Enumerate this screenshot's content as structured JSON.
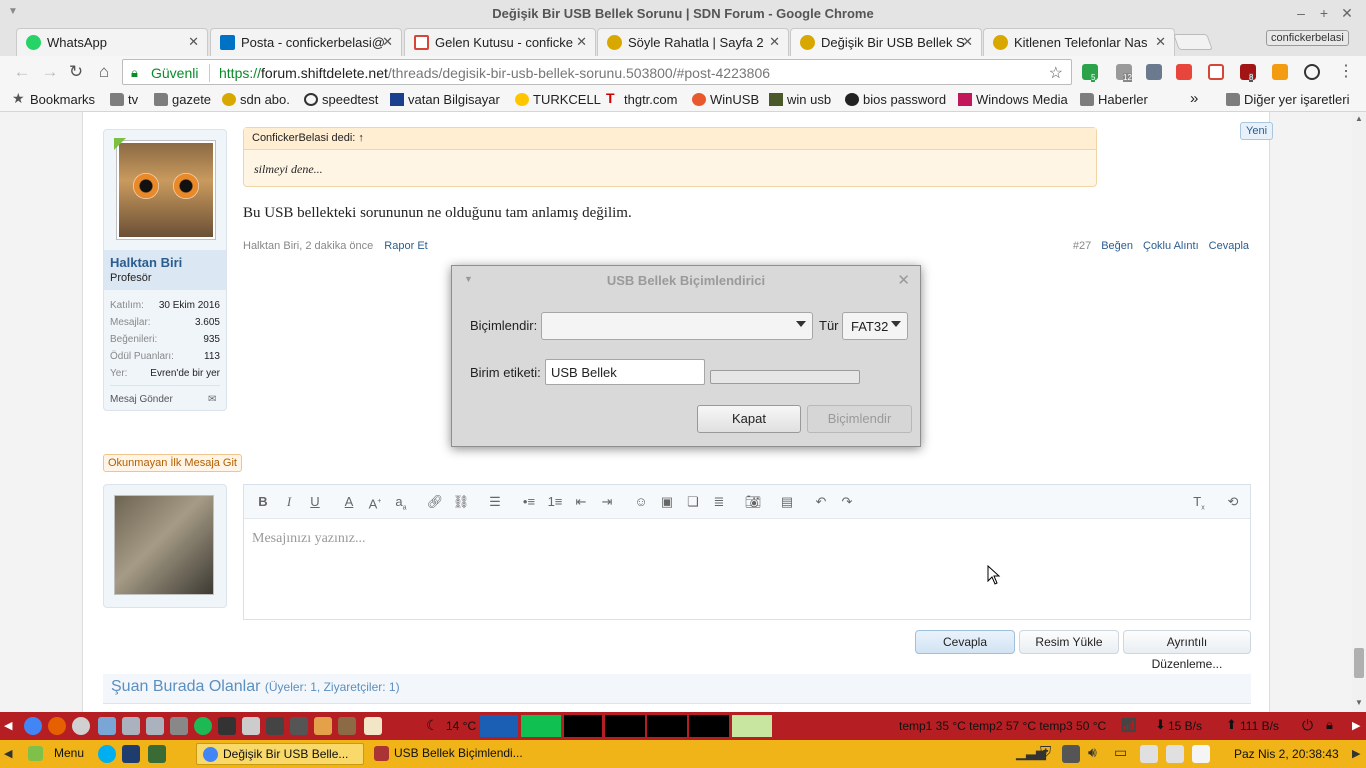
{
  "window": {
    "title": "Değişik Bir USB Bellek Sorunu | SDN Forum - Google Chrome"
  },
  "tabs": [
    {
      "label": "WhatsApp",
      "color": "#25d366"
    },
    {
      "label": "Posta - confickerbelasi@",
      "color": "#0072c6"
    },
    {
      "label": "Gelen Kutusu - conficke",
      "color": "#d44638"
    },
    {
      "label": "Söyle Rahatla | Sayfa 2",
      "color": "#d8a800"
    },
    {
      "label": "Değişik Bir USB Bellek S",
      "color": "#d8a800"
    },
    {
      "label": "Kitlenen Telefonlar Nas",
      "color": "#d8a800"
    }
  ],
  "profile_name": "confickerbelasi",
  "omnibox": {
    "secure_label": "Güvenli",
    "scheme": "https://",
    "host": "forum.shiftdelete.net",
    "path": "/threads/degisik-bir-usb-bellek-sorunu.503800/#post-4223806"
  },
  "extensions": [
    {
      "name": "extension-badge-5",
      "badge": "5"
    },
    {
      "name": "extension-badge-12",
      "badge": "12"
    },
    {
      "name": "extension-badge-8",
      "badge": "8"
    }
  ],
  "bookmarks": {
    "items": [
      "Bookmarks",
      "tv",
      "gazete",
      "sdn abo.",
      "speedtest",
      "vatan Bilgisayar",
      "TURKCELL",
      "thgtr.com",
      "WinUSB",
      "win usb",
      "bios password",
      "Windows Media",
      "Haberler"
    ],
    "overflow": "»",
    "other": "Diğer yer işaretleri"
  },
  "post": {
    "user": {
      "name": "Halktan Biri",
      "title": "Profesör",
      "stats": [
        {
          "k": "Katılım:",
          "v": "30 Ekim 2016"
        },
        {
          "k": "Mesajlar:",
          "v": "3.605"
        },
        {
          "k": "Beğenileri:",
          "v": "935"
        },
        {
          "k": "Ödül Puanları:",
          "v": "113"
        },
        {
          "k": "Yer:",
          "v": "Evren'de bir yer"
        }
      ],
      "send_message": "Mesaj Gönder"
    },
    "quote_header": "ConfickerBelasi dedi: ↑",
    "quote_body": "silmeyi dene...",
    "message": "Bu USB bellekteki sorununun ne olduğunu tam anlamış değilim.",
    "meta": "Halktan Biri, 2 dakika önce",
    "report": "Rapor Et",
    "number": "#27",
    "actions": [
      "Beğen",
      "Çoklu Alıntı",
      "Cevapla"
    ]
  },
  "new_badge": "Yeni",
  "unread_link": "Okunmayan İlk Mesaja Git",
  "editor": {
    "placeholder": "Mesajınızı yazınız..."
  },
  "form_buttons": {
    "reply": "Cevapla",
    "upload": "Resim Yükle",
    "advanced": "Ayrıntılı Düzenleme..."
  },
  "online_now": {
    "title": "Şuan Burada Olanlar",
    "counts": "(Üyeler: 1, Ziyaretçiler: 1)"
  },
  "dialog": {
    "title": "USB Bellek Biçimlendirici",
    "format_label": "Biçimlendir:",
    "format_value": "",
    "type_label": "Tür",
    "type_value": "FAT32",
    "volume_label": "Birim etiketi:",
    "volume_value": "USB Bellek",
    "progress": 0,
    "close_button": "Kapat",
    "format_button": "Biçimlendir"
  },
  "top_panel": {
    "weather": "14 °C",
    "temps": "temp1 35 °C temp2 57 °C temp3 50 °C",
    "net_down": "15 B/s",
    "net_up": "111 B/s"
  },
  "bottom_panel": {
    "menu_label": "Menu",
    "tasks": [
      "Değişik Bir USB Belle...",
      "USB Bellek Biçimlendi..."
    ],
    "clock": "Paz Nis  2, 20:38:43"
  }
}
